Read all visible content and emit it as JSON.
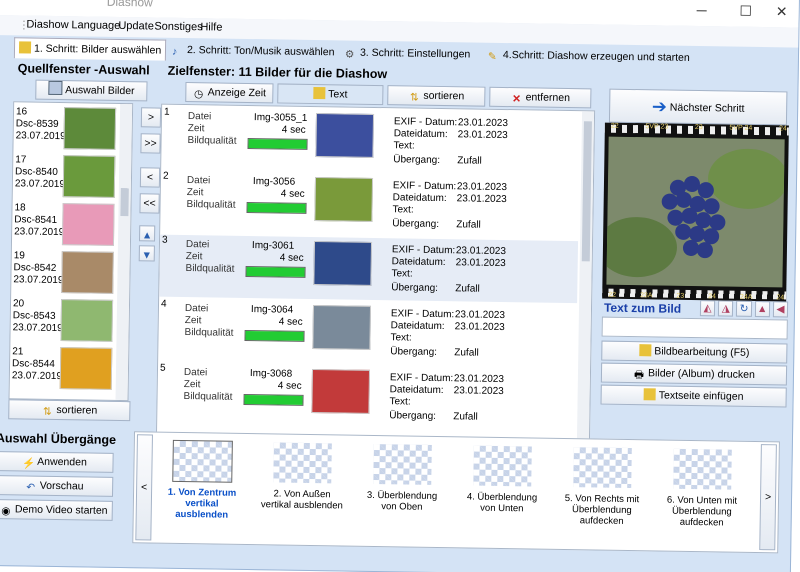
{
  "window": {
    "title": "Diashow",
    "minimize": "─",
    "maximize": "☐",
    "close": "✕"
  },
  "menu": [
    "Diashow",
    "Language",
    "Update",
    "Sonstiges",
    "Hilfe"
  ],
  "tabs": [
    {
      "label": "1. Schritt: Bilder auswählen"
    },
    {
      "label": "2. Schritt: Ton/Musik auswählen"
    },
    {
      "label": "3. Schritt: Einstellungen"
    },
    {
      "label": "4.Schritt: Diashow erzeugen und starten"
    }
  ],
  "source": {
    "title": "Quellfenster -Auswahl",
    "select_button": "Auswahl Bilder",
    "sort_button": "sortieren",
    "items": [
      {
        "num": "16",
        "name": "Dsc-8539",
        "date": "23.07.2019",
        "color": "#5d8a3a"
      },
      {
        "num": "17",
        "name": "Dsc-8540",
        "date": "23.07.2019",
        "color": "#6a9a3c"
      },
      {
        "num": "18",
        "name": "Dsc-8541",
        "date": "23.07.2019",
        "color": "#e89ab8"
      },
      {
        "num": "19",
        "name": "Dsc-8542",
        "date": "23.07.2019",
        "color": "#a98a68"
      },
      {
        "num": "20",
        "name": "Dsc-8543",
        "date": "23.07.2019",
        "color": "#8fb870"
      },
      {
        "num": "21",
        "name": "Dsc-8544",
        "date": "23.07.2019",
        "color": "#e0a020"
      }
    ]
  },
  "transfer": {
    "right": ">",
    "all_right": ">>",
    "left": "<",
    "all_left": "<<"
  },
  "target": {
    "title": "Zielfenster: 11 Bilder für die Diashow",
    "buttons": {
      "time": "Anzeige Zeit",
      "text": "Text",
      "sort": "sortieren",
      "remove": "entfernen"
    },
    "labels": {
      "file": "Datei",
      "time": "Zeit",
      "quality": "Bildqualität",
      "exif": "EXIF - Datum:",
      "filedate": "Dateidatum:",
      "text": "Text:",
      "transition": "Übergang:"
    },
    "items": [
      {
        "num": "1",
        "file": "Img-3055_1",
        "time": "4 sec",
        "quality": 1.0,
        "exif": "23.01.2023",
        "filedate": "23.01.2023",
        "transition": "Zufall",
        "color": "#3c4f9e"
      },
      {
        "num": "2",
        "file": "Img-3056",
        "time": "4 sec",
        "quality": 1.0,
        "exif": "23.01.2023",
        "filedate": "23.01.2023",
        "transition": "Zufall",
        "color": "#7a9a3a"
      },
      {
        "num": "3",
        "file": "Img-3061",
        "time": "4 sec",
        "quality": 1.0,
        "exif": "23.01.2023",
        "filedate": "23.01.2023",
        "transition": "Zufall",
        "color": "#2e4a8a"
      },
      {
        "num": "4",
        "file": "Img-3064",
        "time": "4 sec",
        "quality": 1.0,
        "exif": "23.01.2023",
        "filedate": "23.01.2023",
        "transition": "Zufall",
        "color": "#7a8a9a"
      },
      {
        "num": "5",
        "file": "Img-3068",
        "time": "4 sec",
        "quality": 1.0,
        "exif": "23.01.2023",
        "filedate": "23.01.2023",
        "transition": "Zufall",
        "color": "#c23a3a"
      }
    ]
  },
  "right": {
    "next_button": "Nächster Schritt",
    "text_title": "Text zum Bild",
    "text_value": "",
    "edit_button": "Bildbearbeitung (F5)",
    "print_button": "Bilder (Album) drucken",
    "textpage_button": "Textseite einfügen",
    "film_top": [
      "22",
      "5VP 23",
      "23",
      "5VP 24",
      "24"
    ],
    "film_bottom": [
      "22",
      "23A",
      "23",
      "24",
      "24A",
      "24"
    ]
  },
  "transitions": {
    "title": "Auswahl Übergänge",
    "apply": "Anwenden",
    "preview": "Vorschau",
    "demo": "Demo Video starten",
    "items": [
      {
        "label": "1. Von Zentrum vertikal ausblenden",
        "selected": true
      },
      {
        "label": "2. Von Außen vertikal ausblenden",
        "selected": false
      },
      {
        "label": "3. Überblendung von Oben",
        "selected": false
      },
      {
        "label": "4. Überblendung von Unten",
        "selected": false
      },
      {
        "label": "5. Von Rechts mit Überblendung aufdecken",
        "selected": false
      },
      {
        "label": "6. Von Unten mit Überblendung aufdecken",
        "selected": false
      }
    ],
    "prev": "<",
    "next": ">"
  },
  "colors": {
    "accent": "#0a50c8",
    "panel": "#d4e3f5",
    "quality": "#22cc33"
  }
}
